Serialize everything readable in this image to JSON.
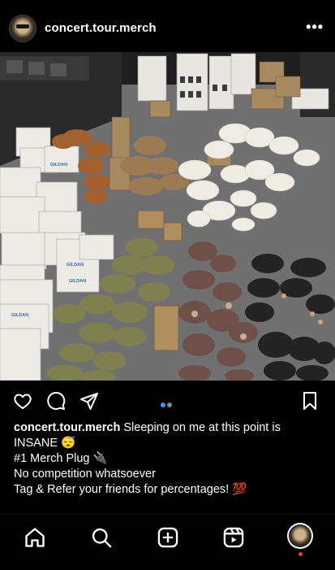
{
  "post": {
    "username": "concert.tour.merch",
    "more_label": "•••",
    "carousel": {
      "current": 1,
      "total": 2
    }
  },
  "caption": {
    "username": "concert.tour.merch",
    "line1": "Sleeping on me at this point is",
    "line2": "INSANE 😴",
    "line3": "#1 Merch Plug 🔌",
    "line4": "No competition whatsoever",
    "line5": "Tag & Refer your friends for percentages! 💯"
  },
  "photo": {
    "box_labels": [
      "GILDAN",
      "GILDAN",
      "GILDAN",
      "GILDAN"
    ]
  },
  "icons": {
    "like": "heart-icon",
    "comment": "comment-icon",
    "share": "send-icon",
    "save": "bookmark-icon",
    "home": "home-icon",
    "search": "search-icon",
    "create": "plus-square-icon",
    "reels": "reels-icon"
  },
  "colors": {
    "background": "#000000",
    "text": "#ffffff",
    "carousel_active": "#3897f0",
    "carousel_inactive": "#888888",
    "notification": "#ff3040"
  }
}
